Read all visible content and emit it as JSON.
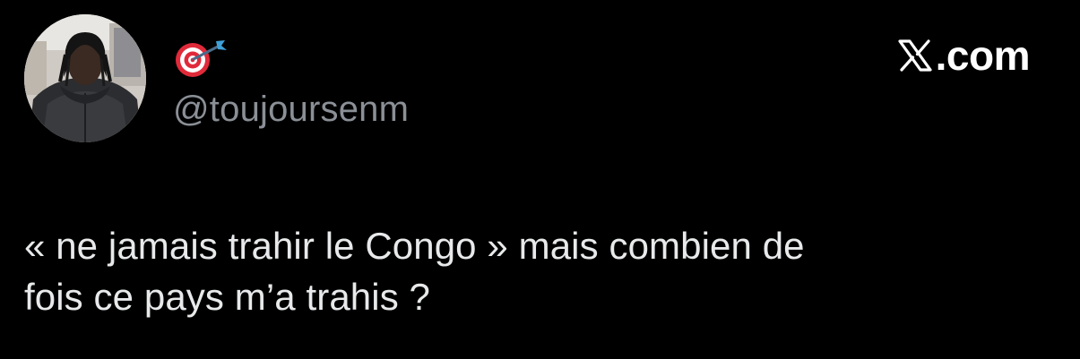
{
  "profile": {
    "avatar_icon": "profile-photo",
    "display_emoji_icon": "direct-hit-dart-emoji",
    "handle": "@toujoursenm"
  },
  "brand": {
    "icon": "x-logo",
    "suffix": ".com"
  },
  "tweet": {
    "line1": "« ne jamais trahir le Congo » mais combien de",
    "line2": "fois ce pays m’a trahis ?"
  },
  "colors": {
    "background": "#000000",
    "text": "#e7e9ea",
    "handle": "#8b9097",
    "brand": "#ffffff"
  }
}
